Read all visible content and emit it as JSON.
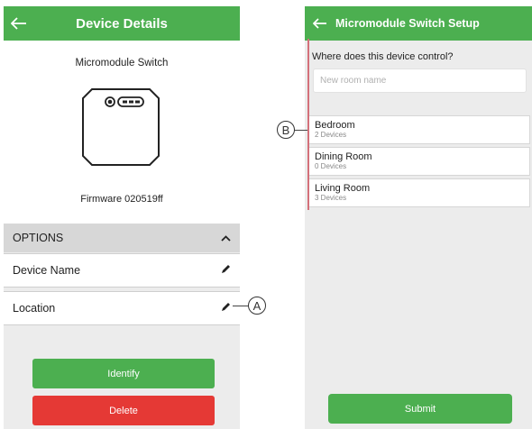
{
  "left": {
    "appbar": {
      "title": "Device Details"
    },
    "device_name": "Micromodule Switch",
    "firmware": "Firmware 020519ff",
    "options": {
      "header": "OPTIONS",
      "rows": [
        {
          "label": "Device Name"
        },
        {
          "label": "Location"
        }
      ]
    },
    "buttons": {
      "identify": "Identify",
      "delete": "Delete"
    }
  },
  "right": {
    "appbar": {
      "title": "Micromodule Switch Setup"
    },
    "question": "Where does this device control?",
    "room_input": {
      "placeholder": "New room name",
      "value": ""
    },
    "rooms": [
      {
        "name": "Bedroom",
        "count": "2 Devices"
      },
      {
        "name": "Dining Room",
        "count": "0 Devices"
      },
      {
        "name": "Living Room",
        "count": "3 Devices"
      }
    ],
    "submit": "Submit"
  },
  "callouts": {
    "a": "A",
    "b": "B"
  },
  "colors": {
    "primary": "#4caf50",
    "danger": "#e53935",
    "callout_line": "#d4707a"
  },
  "icons": [
    "back-arrow-icon",
    "chevron-up-icon",
    "pencil-icon",
    "device-module-icon"
  ]
}
